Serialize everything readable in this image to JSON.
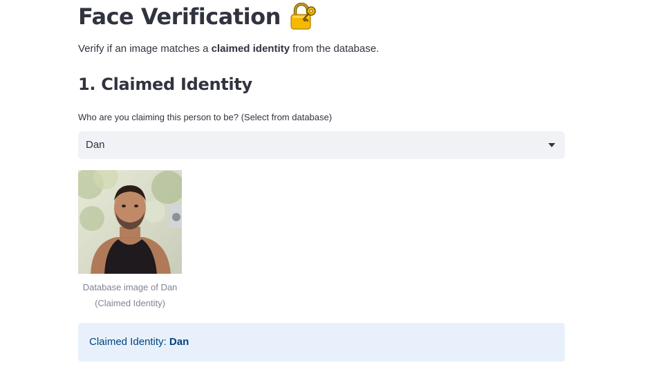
{
  "header": {
    "title": "Face Verification",
    "title_icon": "lock-with-key-icon"
  },
  "intro": {
    "prefix": "Verify if an image matches a ",
    "bold": "claimed identity",
    "suffix": " from the database."
  },
  "section1": {
    "heading": "1. Claimed Identity",
    "select_label": "Who are you claiming this person to be? (Select from database)",
    "select_value": "Dan",
    "image_caption_line1": "Database image of Dan",
    "image_caption_line2": "(Claimed Identity)",
    "info_prefix": "Claimed Identity: ",
    "info_value": "Dan"
  },
  "colors": {
    "text": "#31333f",
    "select_bg": "#f0f2f6",
    "info_bg": "#e8f1fb",
    "info_text": "#004280",
    "caption": "#808495"
  }
}
